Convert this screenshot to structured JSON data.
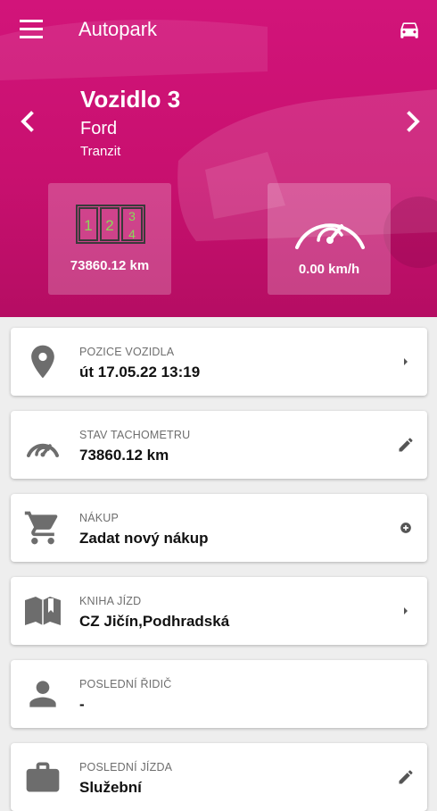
{
  "app": {
    "title": "Autopark"
  },
  "icons": {
    "menu": "menu-icon",
    "car": "car-icon",
    "prev": "chevron-left-icon",
    "next": "chevron-right-icon"
  },
  "vehicle": {
    "name": "Vozidlo 3",
    "make": "Ford",
    "model": "Tranzit"
  },
  "tiles": {
    "odometer": {
      "digits": [
        "1",
        "2",
        "3",
        "4"
      ],
      "value": "73860.12 km"
    },
    "speed": {
      "value": "0.00 km/h"
    }
  },
  "cards": [
    {
      "label": "POZICE VOZIDLA",
      "value": "út 17.05.22 13:19",
      "icon": "location-pin-icon",
      "action": "chevron-right-icon"
    },
    {
      "label": "STAV TACHOMETRU",
      "value": "73860.12 km",
      "icon": "speedometer-icon",
      "action": "edit-icon"
    },
    {
      "label": "NÁKUP",
      "value": "Zadat nový nákup",
      "icon": "shopping-cart-icon",
      "action": "add-circle-icon"
    },
    {
      "label": "KNIHA JÍZD",
      "value": "CZ Jičín,Podhradská",
      "icon": "book-icon",
      "action": "chevron-right-icon"
    },
    {
      "label": "POSLEDNÍ ŘIDIČ",
      "value": "-",
      "icon": "person-icon",
      "action": ""
    },
    {
      "label": "POSLEDNÍ JÍZDA",
      "value": "Služební",
      "icon": "briefcase-icon",
      "action": "edit-icon"
    }
  ],
  "colors": {
    "brand": "#c8106f",
    "odometer_digits": "#8bd85a",
    "icon_gray": "#6d6d6d"
  }
}
